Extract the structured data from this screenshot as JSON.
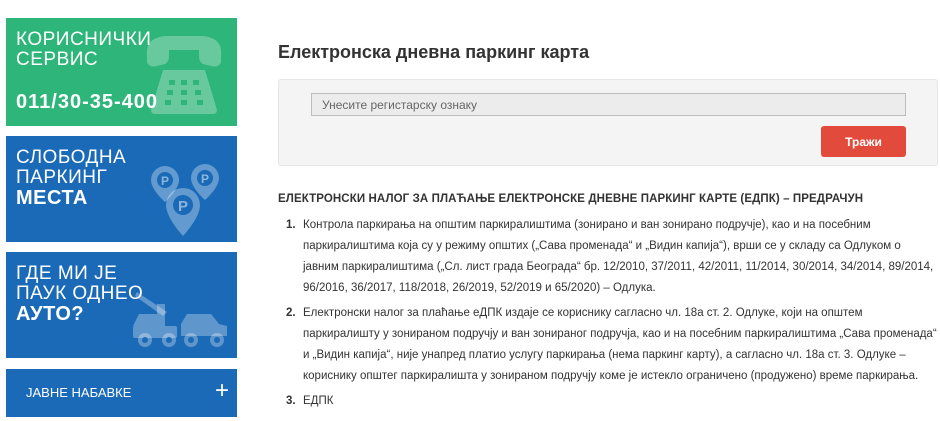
{
  "sidebar": {
    "customer_service": {
      "line1": "КОРИСНИЧКИ",
      "line2": "СЕРВИС",
      "phone": "011/30-35-400",
      "icon": "phone-icon"
    },
    "free_parking": {
      "line1": "СЛОБОДНА",
      "line2": "ПАРКИНГ",
      "line3": "МЕСТА",
      "icon": "parking-pins-icon"
    },
    "tow_truck": {
      "line1": "ГДЕ МИ ЈЕ",
      "line2": "ПАУК ОДНЕО",
      "line3": "АУТО?",
      "icon": "tow-truck-icon"
    },
    "procurement": {
      "label": "ЈАВНЕ НАБАВКЕ",
      "toggle": "+"
    }
  },
  "main": {
    "title": "Електронска дневна паркинг карта",
    "search": {
      "placeholder": "Унесите регистарску ознаку",
      "value": "",
      "button": "Тражи"
    },
    "section_heading": "ЕЛЕКТРОНСКИ НАЛОГ ЗА ПЛАЋАЊЕ ЕЛЕКТРОНСКЕ ДНЕВНЕ ПАРКИНГ КАРТЕ (ЕДПК) – ПРЕДРАЧУН",
    "items": [
      {
        "num": "1.",
        "text": "Контрола паркирања на општим паркиралиштима (зонирано и ван зонирано подручје), као и на посебним паркиралиштима која су у режиму општих („Сава променада“ и „Видин капија“), врши се у складу са Одлуком о јавним паркиралиштима („Сл. лист града Београда“ бр. 12/2010, 37/2011, 42/2011, 11/2014, 30/2014, 34/2014, 89/2014, 96/2016, 36/2017, 118/2018, 26/2019, 52/2019 и 65/2020) – Одлука."
      },
      {
        "num": "2.",
        "text": "Електронски налог за плаћање еДПК издаје се кориснику сагласно чл. 18а ст. 2. Одлуке, који на општем паркиралишту у зонираном подручју и ван зонираног подручја, као и на посебним паркиралиштима „Сава променада“ и „Видин капија“, није унапред платио услугу паркирања (нема паркинг карту), а сагласно чл. 18а ст. 3. Одлуке – кориснику општег паркиралишта у зонираном подручју коме је истекло ограничено (продужено) време паркирања."
      },
      {
        "num": "3.",
        "text": "ЕДПК"
      }
    ]
  },
  "colors": {
    "green_tile": "#2eb57a",
    "blue_tile": "#1a6ab8",
    "search_button": "#e24b3c"
  }
}
